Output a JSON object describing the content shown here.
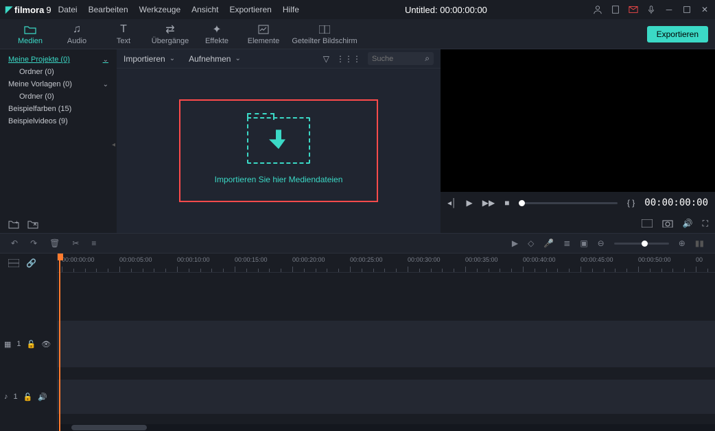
{
  "app": {
    "name": "filmora",
    "version": "9"
  },
  "menus": [
    "Datei",
    "Bearbeiten",
    "Werkzeuge",
    "Ansicht",
    "Exportieren",
    "Hilfe"
  ],
  "title": "Untitled: 00:00:00:00",
  "toolTabs": [
    {
      "id": "medien",
      "label": "Medien",
      "active": true
    },
    {
      "id": "audio",
      "label": "Audio"
    },
    {
      "id": "text",
      "label": "Text"
    },
    {
      "id": "uebergaenge",
      "label": "Übergänge"
    },
    {
      "id": "effekte",
      "label": "Effekte"
    },
    {
      "id": "elemente",
      "label": "Elemente"
    },
    {
      "id": "splitscreen",
      "label": "Geteilter Bildschirm"
    }
  ],
  "exportLabel": "Exportieren",
  "sidebar": {
    "items": [
      {
        "label": "Meine Projekte (0)",
        "active": true,
        "expandable": true
      },
      {
        "label": "Ordner (0)",
        "sub": true
      },
      {
        "label": "Meine Vorlagen (0)",
        "expandable": true
      },
      {
        "label": "Ordner (0)",
        "sub": true
      },
      {
        "label": "Beispielfarben (15)"
      },
      {
        "label": "Beispielvideos (9)"
      }
    ]
  },
  "mediaBar": {
    "import": "Importieren",
    "record": "Aufnehmen",
    "searchPlaceholder": "Suche"
  },
  "dropzone": {
    "text": "Importieren Sie hier Mediendateien"
  },
  "preview": {
    "markers": "{  }",
    "timecode": "00:00:00:00"
  },
  "timeline": {
    "videoTrack": "1",
    "audioTrack": "1",
    "marks": [
      "00:00:00:00",
      "00:00:05:00",
      "00:00:10:00",
      "00:00:15:00",
      "00:00:20:00",
      "00:00:25:00",
      "00:00:30:00",
      "00:00:35:00",
      "00:00:40:00",
      "00:00:45:00",
      "00:00:50:00",
      "00"
    ]
  }
}
